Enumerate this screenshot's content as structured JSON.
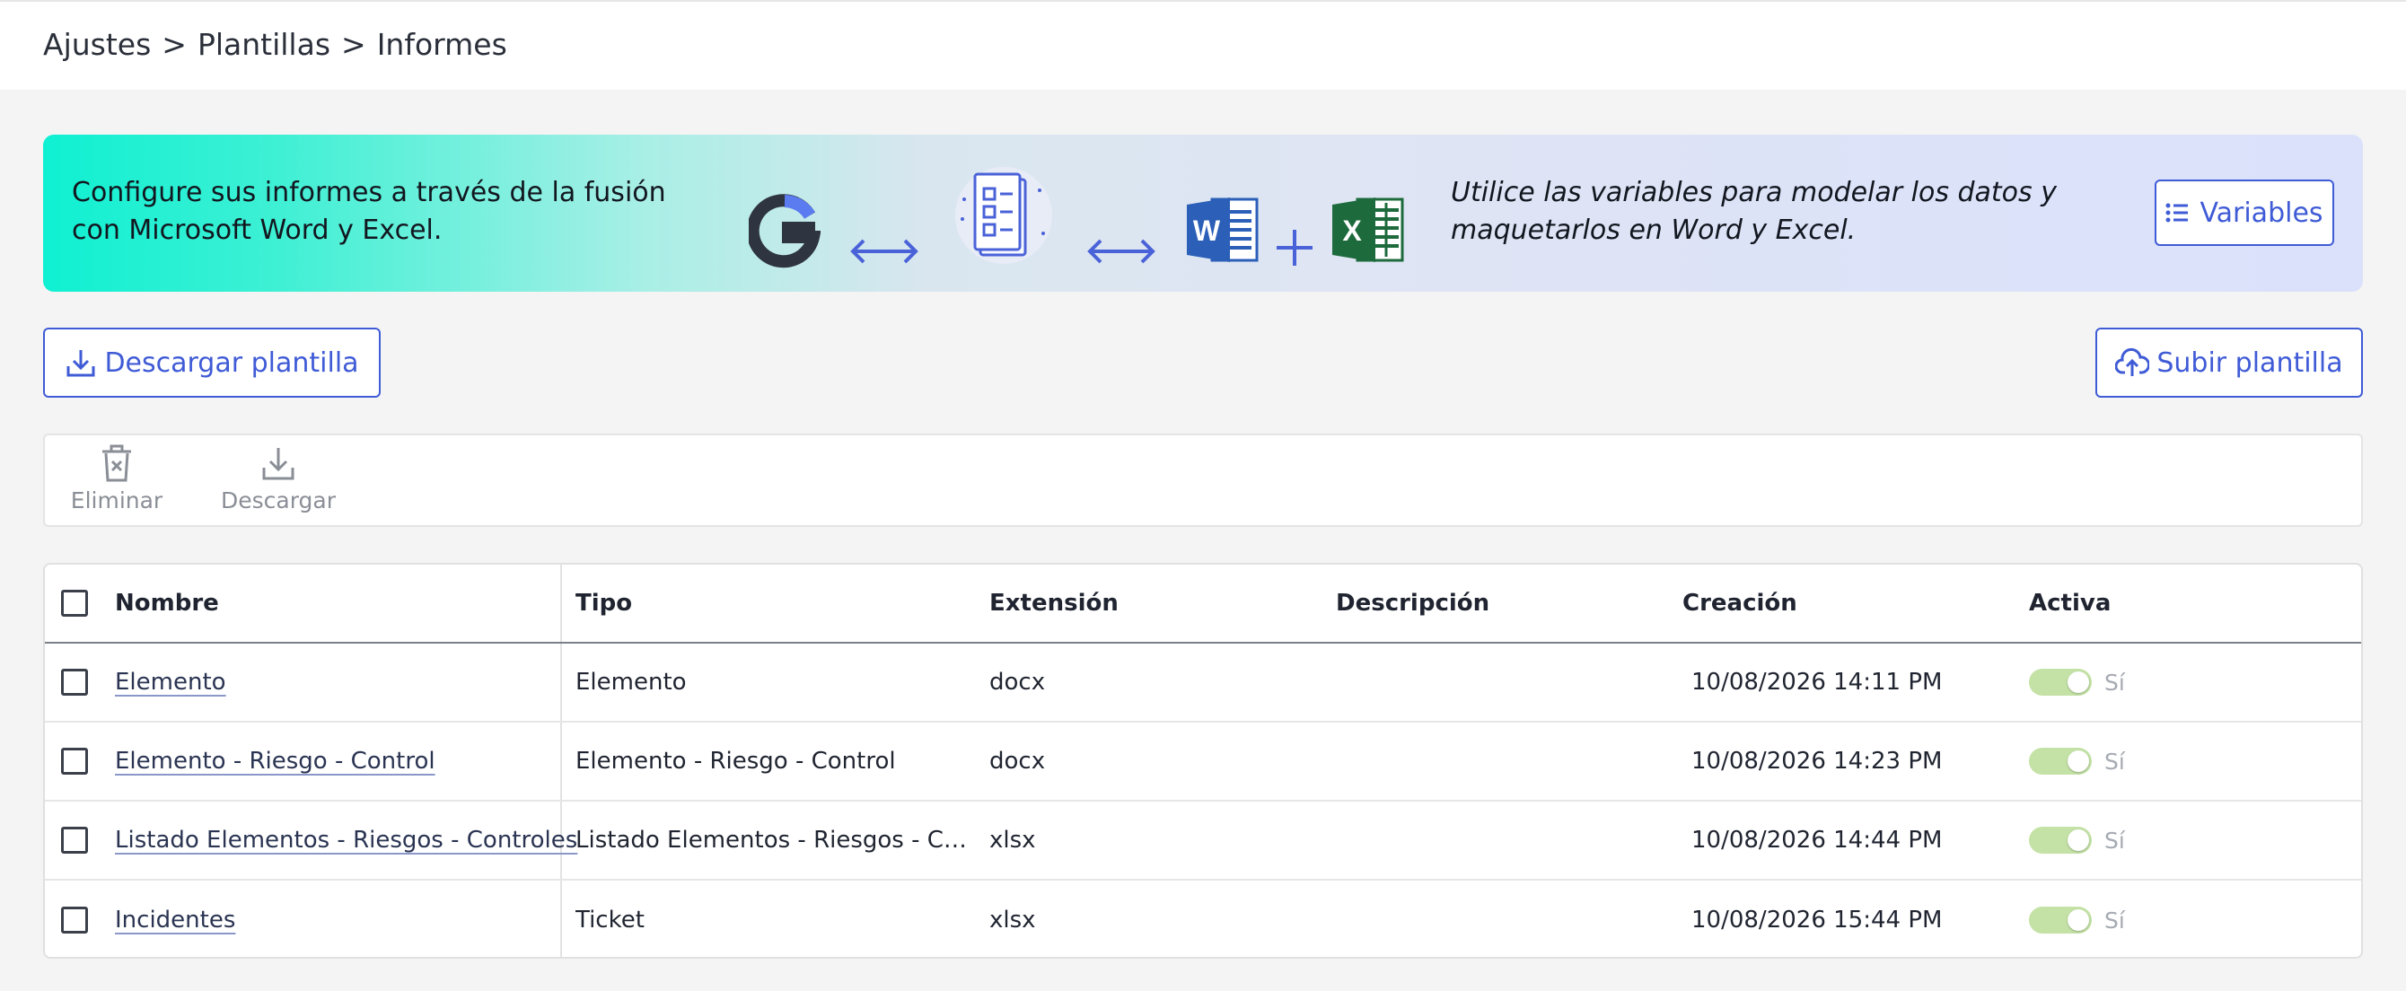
{
  "breadcrumb": {
    "items": [
      "Ajustes",
      "Plantillas",
      "Informes"
    ],
    "separator": ">"
  },
  "banner": {
    "text": "Configure sus informes a través de la fusión con Microsoft Word y Excel.",
    "hint": "Utilice las variables para modelar los datos y maquetarlos en Word y Excel.",
    "variables_button": "Variables",
    "icons": [
      "logo-g-icon",
      "double-arrow-icon",
      "checklist-document-icon",
      "double-arrow-icon",
      "word-icon",
      "plus-icon",
      "excel-icon"
    ],
    "gradient_start": "#0ff0d2",
    "gradient_end": "#dbe1fb"
  },
  "actions": {
    "download_template": "Descargar plantilla",
    "upload_template": "Subir plantilla"
  },
  "toolbar": {
    "delete_label": "Eliminar",
    "download_label": "Descargar"
  },
  "table": {
    "columns": [
      "Nombre",
      "Tipo",
      "Extensión",
      "Descripción",
      "Creación",
      "Activa"
    ],
    "rows": [
      {
        "name": "Elemento",
        "type": "Elemento",
        "extension": "docx",
        "description": "",
        "created": "10/08/2026 14:11 PM",
        "active": "Sí",
        "active_on": true
      },
      {
        "name": "Elemento - Riesgo - Control",
        "type": "Elemento - Riesgo - Control",
        "extension": "docx",
        "description": "",
        "created": "10/08/2026 14:23 PM",
        "active": "Sí",
        "active_on": true
      },
      {
        "name": "Listado Elementos - Riesgos - Controles",
        "type": "Listado Elementos - Riesgos - Con...",
        "extension": "xlsx",
        "description": "",
        "created": "10/08/2026 14:44 PM",
        "active": "Sí",
        "active_on": true
      },
      {
        "name": "Incidentes",
        "type": "Ticket",
        "extension": "xlsx",
        "description": "",
        "created": "10/08/2026 15:44 PM",
        "active": "Sí",
        "active_on": true
      }
    ]
  },
  "colors": {
    "accent": "#3f5bd6",
    "toggle_on": "#c4e2a6",
    "word_blue": "#2b5fb8",
    "excel_green": "#1d6b3c"
  }
}
